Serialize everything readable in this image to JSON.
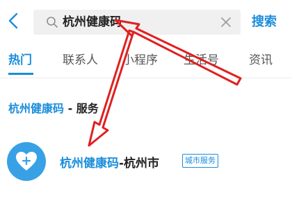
{
  "header": {
    "back_icon": "chevron-left-icon",
    "search_icon": "search-icon",
    "search_value": "杭州健康码",
    "clear_icon": "close-icon",
    "search_button_label": "搜索"
  },
  "tabs": [
    {
      "label": "热门",
      "active": true
    },
    {
      "label": "联系人",
      "active": false
    },
    {
      "label": "小程序",
      "active": false
    },
    {
      "label": "生活号",
      "active": false
    },
    {
      "label": "资讯",
      "active": false
    }
  ],
  "section": {
    "keyword": "杭州健康码",
    "suffix": " - 服务"
  },
  "result": {
    "icon": "heart-plus-icon",
    "keyword": "杭州健康码",
    "suffix": "-杭州市",
    "tag": "城市服务"
  },
  "colors": {
    "accent": "#1a8ddb",
    "icon_bg": "#38a1e6",
    "annotation": "#e02020",
    "search_bg": "#f0f0f0"
  }
}
